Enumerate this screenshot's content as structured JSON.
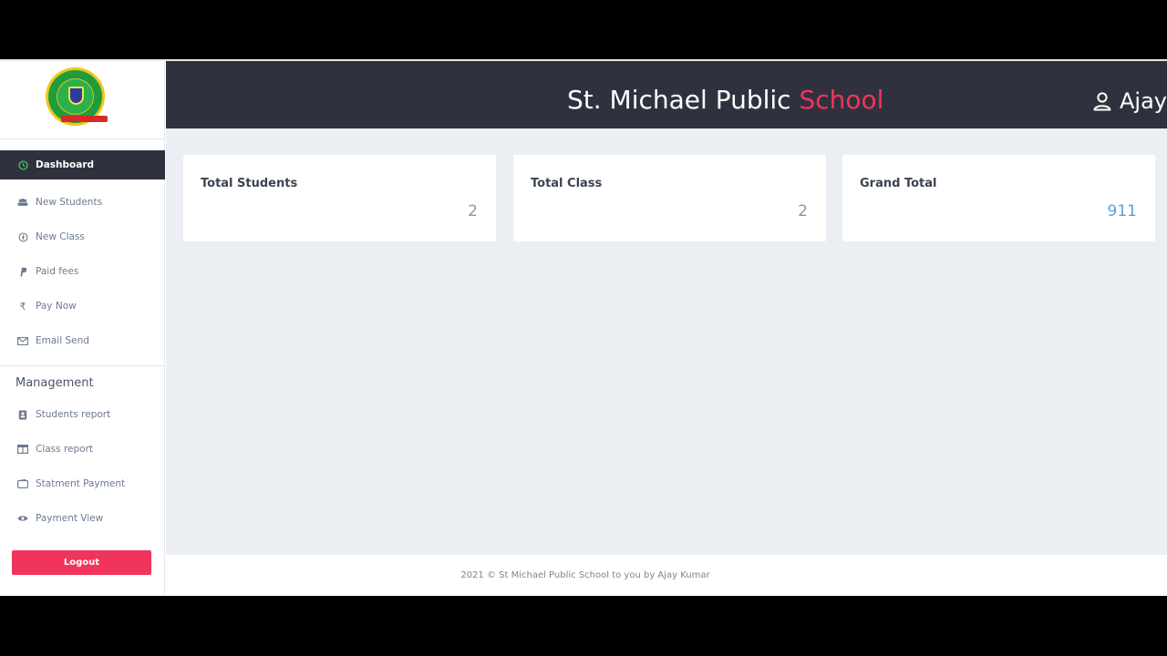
{
  "header": {
    "brand_main": "St. Michael Public",
    "brand_accent": "School",
    "user_name": "Ajay"
  },
  "sidebar": {
    "items": [
      {
        "label": "Dashboard",
        "icon": "clock-icon"
      },
      {
        "label": "New Students",
        "icon": "users-icon"
      },
      {
        "label": "New Class",
        "icon": "compass-icon"
      },
      {
        "label": "Paid fees",
        "icon": "paypal-icon"
      },
      {
        "label": "Pay Now",
        "icon": "rupee-icon"
      },
      {
        "label": "Email Send",
        "icon": "envelope-icon"
      }
    ],
    "management_title": "Management",
    "management_items": [
      {
        "label": "Students report",
        "icon": "contact-book-icon"
      },
      {
        "label": "Class report",
        "icon": "table-icon"
      },
      {
        "label": "Statment Payment",
        "icon": "wallet-icon"
      },
      {
        "label": "Payment View",
        "icon": "eye-icon"
      }
    ],
    "logout_label": "Logout"
  },
  "cards": [
    {
      "title": "Total Students",
      "value": "2"
    },
    {
      "title": "Total Class",
      "value": "2"
    },
    {
      "title": "Grand Total",
      "value": "911"
    }
  ],
  "footer": {
    "text": "2021 © St Michael Public School to you by Ajay Kumar"
  },
  "colors": {
    "accent": "#f1345c",
    "header_bg": "#2f323e",
    "active_icon": "#36c36a",
    "grand_total": "#5a9fd8"
  }
}
